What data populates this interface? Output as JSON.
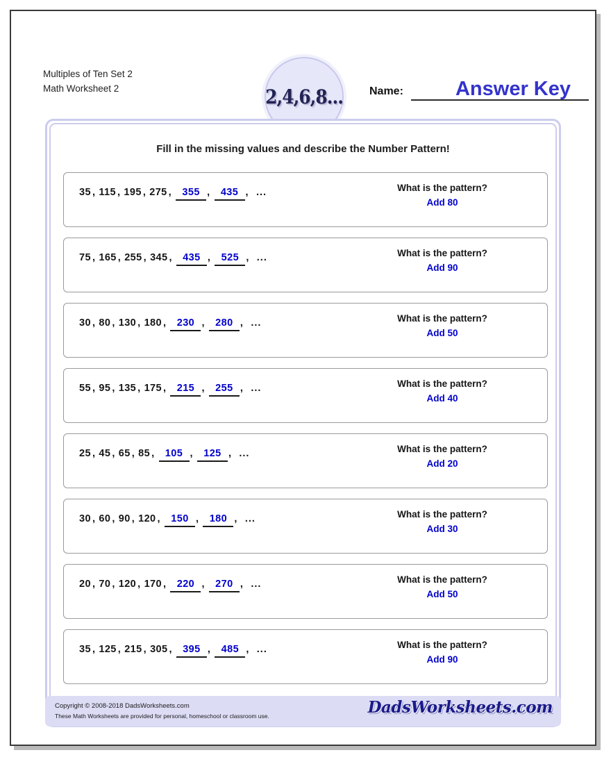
{
  "header": {
    "title_line1": "Multiples of Ten Set 2",
    "title_line2": "Math Worksheet 2",
    "logo_text": "2,4,6,8...",
    "name_label": "Name:",
    "name_value": "Answer Key"
  },
  "instructions": "Fill in the missing values and describe the Number Pattern!",
  "colors": {
    "answer_blue": "#0000cc",
    "answer_key_blue": "#3333cc",
    "panel_border": "#ccccee",
    "footer_bg": "#dcdcf5"
  },
  "pattern_question_label": "What is the pattern?",
  "problems": [
    {
      "given": [
        "35",
        "115",
        "195",
        "275"
      ],
      "answers": [
        "355",
        "435"
      ],
      "ellipsis": "...",
      "question": "What is the pattern?",
      "answer_text": "Add 80"
    },
    {
      "given": [
        "75",
        "165",
        "255",
        "345"
      ],
      "answers": [
        "435",
        "525"
      ],
      "ellipsis": "...",
      "question": "What is the pattern?",
      "answer_text": "Add 90"
    },
    {
      "given": [
        "30",
        "80",
        "130",
        "180"
      ],
      "answers": [
        "230",
        "280"
      ],
      "ellipsis": "...",
      "question": "What is the pattern?",
      "answer_text": "Add 50"
    },
    {
      "given": [
        "55",
        "95",
        "135",
        "175"
      ],
      "answers": [
        "215",
        "255"
      ],
      "ellipsis": "...",
      "question": "What is the pattern?",
      "answer_text": "Add 40"
    },
    {
      "given": [
        "25",
        "45",
        "65",
        "85"
      ],
      "answers": [
        "105",
        "125"
      ],
      "ellipsis": "...",
      "question": "What is the pattern?",
      "answer_text": "Add 20"
    },
    {
      "given": [
        "30",
        "60",
        "90",
        "120"
      ],
      "answers": [
        "150",
        "180"
      ],
      "ellipsis": "...",
      "question": "What is the pattern?",
      "answer_text": "Add 30"
    },
    {
      "given": [
        "20",
        "70",
        "120",
        "170"
      ],
      "answers": [
        "220",
        "270"
      ],
      "ellipsis": "...",
      "question": "What is the pattern?",
      "answer_text": "Add 50"
    },
    {
      "given": [
        "35",
        "125",
        "215",
        "305"
      ],
      "answers": [
        "395",
        "485"
      ],
      "ellipsis": "...",
      "question": "What is the pattern?",
      "answer_text": "Add 90"
    }
  ],
  "footer": {
    "copyright": "Copyright © 2008-2018 DadsWorksheets.com",
    "usage": "These Math Worksheets are provided for personal, homeschool or classroom use.",
    "logo": "DadsWorksheets.com"
  }
}
